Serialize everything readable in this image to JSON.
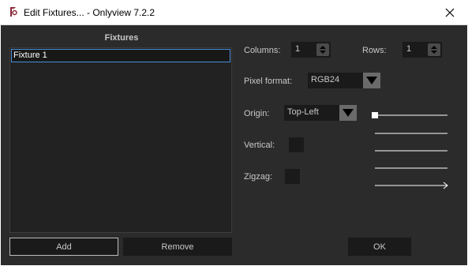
{
  "window": {
    "title": "Edit Fixtures... - Onlyview  7.2.2",
    "close_icon": "close-icon",
    "app_icon": "onlyview-logo-icon"
  },
  "fixtures": {
    "title": "Fixtures",
    "items": [
      "Fixture 1"
    ],
    "selected_index": 0,
    "add_label": "Add",
    "remove_label": "Remove"
  },
  "settings": {
    "columns_label": "Columns:",
    "columns_value": "1",
    "rows_label": "Rows:",
    "rows_value": "1",
    "pixel_format_label": "Pixel format:",
    "pixel_format_value": "RGB24",
    "origin_label": "Origin:",
    "origin_value": "Top-Left",
    "vertical_label": "Vertical:",
    "vertical_checked": false,
    "zigzag_label": "Zigzag:",
    "zigzag_checked": false
  },
  "ok_label": "OK",
  "colors": {
    "background": "#2b2b2b",
    "field": "#1a1a1a",
    "text": "#c8c8c8",
    "selection_border": "#4a8fd9"
  }
}
